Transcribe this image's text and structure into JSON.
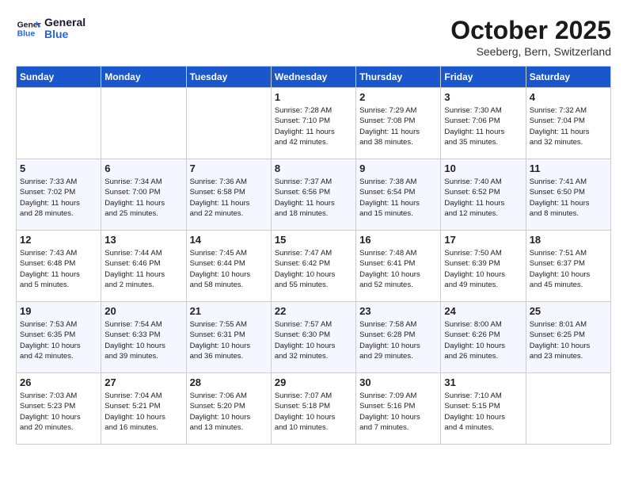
{
  "header": {
    "logo_general": "General",
    "logo_blue": "Blue",
    "month": "October 2025",
    "location": "Seeberg, Bern, Switzerland"
  },
  "days_of_week": [
    "Sunday",
    "Monday",
    "Tuesday",
    "Wednesday",
    "Thursday",
    "Friday",
    "Saturday"
  ],
  "weeks": [
    [
      {
        "day": "",
        "info": ""
      },
      {
        "day": "",
        "info": ""
      },
      {
        "day": "",
        "info": ""
      },
      {
        "day": "1",
        "info": "Sunrise: 7:28 AM\nSunset: 7:10 PM\nDaylight: 11 hours\nand 42 minutes."
      },
      {
        "day": "2",
        "info": "Sunrise: 7:29 AM\nSunset: 7:08 PM\nDaylight: 11 hours\nand 38 minutes."
      },
      {
        "day": "3",
        "info": "Sunrise: 7:30 AM\nSunset: 7:06 PM\nDaylight: 11 hours\nand 35 minutes."
      },
      {
        "day": "4",
        "info": "Sunrise: 7:32 AM\nSunset: 7:04 PM\nDaylight: 11 hours\nand 32 minutes."
      }
    ],
    [
      {
        "day": "5",
        "info": "Sunrise: 7:33 AM\nSunset: 7:02 PM\nDaylight: 11 hours\nand 28 minutes."
      },
      {
        "day": "6",
        "info": "Sunrise: 7:34 AM\nSunset: 7:00 PM\nDaylight: 11 hours\nand 25 minutes."
      },
      {
        "day": "7",
        "info": "Sunrise: 7:36 AM\nSunset: 6:58 PM\nDaylight: 11 hours\nand 22 minutes."
      },
      {
        "day": "8",
        "info": "Sunrise: 7:37 AM\nSunset: 6:56 PM\nDaylight: 11 hours\nand 18 minutes."
      },
      {
        "day": "9",
        "info": "Sunrise: 7:38 AM\nSunset: 6:54 PM\nDaylight: 11 hours\nand 15 minutes."
      },
      {
        "day": "10",
        "info": "Sunrise: 7:40 AM\nSunset: 6:52 PM\nDaylight: 11 hours\nand 12 minutes."
      },
      {
        "day": "11",
        "info": "Sunrise: 7:41 AM\nSunset: 6:50 PM\nDaylight: 11 hours\nand 8 minutes."
      }
    ],
    [
      {
        "day": "12",
        "info": "Sunrise: 7:43 AM\nSunset: 6:48 PM\nDaylight: 11 hours\nand 5 minutes."
      },
      {
        "day": "13",
        "info": "Sunrise: 7:44 AM\nSunset: 6:46 PM\nDaylight: 11 hours\nand 2 minutes."
      },
      {
        "day": "14",
        "info": "Sunrise: 7:45 AM\nSunset: 6:44 PM\nDaylight: 10 hours\nand 58 minutes."
      },
      {
        "day": "15",
        "info": "Sunrise: 7:47 AM\nSunset: 6:42 PM\nDaylight: 10 hours\nand 55 minutes."
      },
      {
        "day": "16",
        "info": "Sunrise: 7:48 AM\nSunset: 6:41 PM\nDaylight: 10 hours\nand 52 minutes."
      },
      {
        "day": "17",
        "info": "Sunrise: 7:50 AM\nSunset: 6:39 PM\nDaylight: 10 hours\nand 49 minutes."
      },
      {
        "day": "18",
        "info": "Sunrise: 7:51 AM\nSunset: 6:37 PM\nDaylight: 10 hours\nand 45 minutes."
      }
    ],
    [
      {
        "day": "19",
        "info": "Sunrise: 7:53 AM\nSunset: 6:35 PM\nDaylight: 10 hours\nand 42 minutes."
      },
      {
        "day": "20",
        "info": "Sunrise: 7:54 AM\nSunset: 6:33 PM\nDaylight: 10 hours\nand 39 minutes."
      },
      {
        "day": "21",
        "info": "Sunrise: 7:55 AM\nSunset: 6:31 PM\nDaylight: 10 hours\nand 36 minutes."
      },
      {
        "day": "22",
        "info": "Sunrise: 7:57 AM\nSunset: 6:30 PM\nDaylight: 10 hours\nand 32 minutes."
      },
      {
        "day": "23",
        "info": "Sunrise: 7:58 AM\nSunset: 6:28 PM\nDaylight: 10 hours\nand 29 minutes."
      },
      {
        "day": "24",
        "info": "Sunrise: 8:00 AM\nSunset: 6:26 PM\nDaylight: 10 hours\nand 26 minutes."
      },
      {
        "day": "25",
        "info": "Sunrise: 8:01 AM\nSunset: 6:25 PM\nDaylight: 10 hours\nand 23 minutes."
      }
    ],
    [
      {
        "day": "26",
        "info": "Sunrise: 7:03 AM\nSunset: 5:23 PM\nDaylight: 10 hours\nand 20 minutes."
      },
      {
        "day": "27",
        "info": "Sunrise: 7:04 AM\nSunset: 5:21 PM\nDaylight: 10 hours\nand 16 minutes."
      },
      {
        "day": "28",
        "info": "Sunrise: 7:06 AM\nSunset: 5:20 PM\nDaylight: 10 hours\nand 13 minutes."
      },
      {
        "day": "29",
        "info": "Sunrise: 7:07 AM\nSunset: 5:18 PM\nDaylight: 10 hours\nand 10 minutes."
      },
      {
        "day": "30",
        "info": "Sunrise: 7:09 AM\nSunset: 5:16 PM\nDaylight: 10 hours\nand 7 minutes."
      },
      {
        "day": "31",
        "info": "Sunrise: 7:10 AM\nSunset: 5:15 PM\nDaylight: 10 hours\nand 4 minutes."
      },
      {
        "day": "",
        "info": ""
      }
    ]
  ]
}
